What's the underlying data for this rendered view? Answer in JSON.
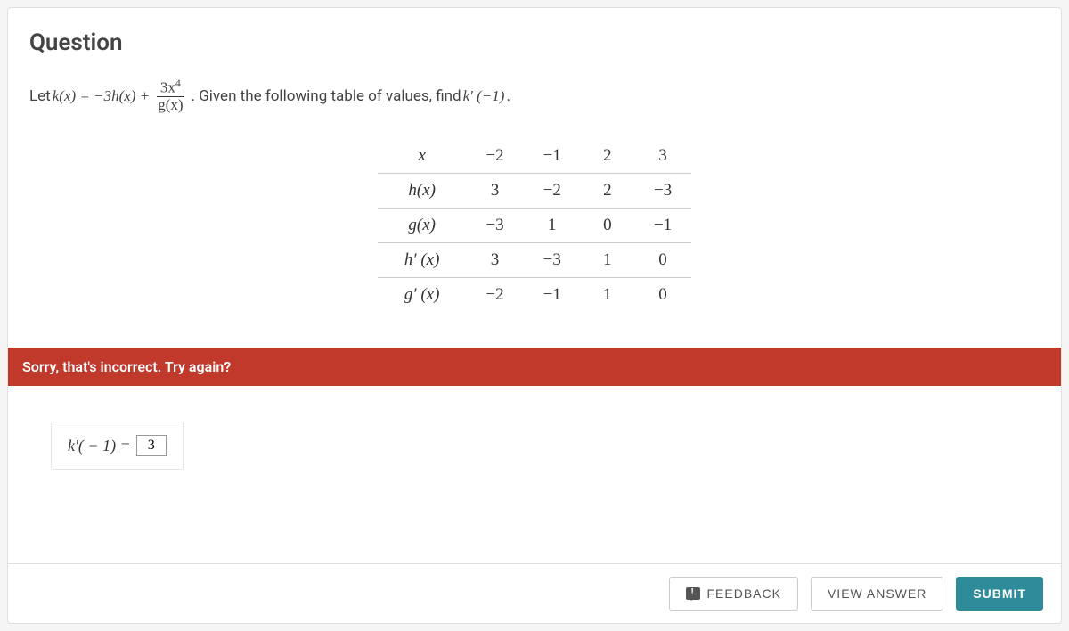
{
  "title": "Question",
  "prompt": {
    "lead": "Let ",
    "eq_lhs": "k(x) = −3h(x) + ",
    "frac_num": "3x",
    "frac_num_exp": "4",
    "frac_den": "g(x)",
    "mid": ". Given the following table of values, find ",
    "target": "k′ (−1)",
    "end": "."
  },
  "table": {
    "headers": [
      "x",
      "−2",
      "−1",
      "2",
      "3"
    ],
    "rows": [
      {
        "label": "h(x)",
        "vals": [
          "3",
          "−2",
          "2",
          "−3"
        ]
      },
      {
        "label": "g(x)",
        "vals": [
          "−3",
          "1",
          "0",
          "−1"
        ]
      },
      {
        "label": "h′ (x)",
        "vals": [
          "3",
          "−3",
          "1",
          "0"
        ]
      },
      {
        "label": "g′ (x)",
        "vals": [
          "−2",
          "−1",
          "1",
          "0"
        ]
      }
    ]
  },
  "error_message": "Sorry, that's incorrect. Try again?",
  "answer": {
    "label_before": "k′( − 1) =",
    "value": "3"
  },
  "buttons": {
    "feedback": "FEEDBACK",
    "view_answer": "VIEW ANSWER",
    "submit": "SUBMIT"
  }
}
